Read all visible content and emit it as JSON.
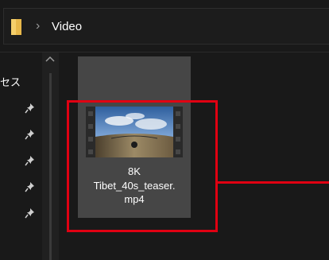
{
  "address_bar": {
    "folder_icon": "folder-icon",
    "separator": "›",
    "breadcrumb": "Video"
  },
  "nav_pane": {
    "partial_label": "セス",
    "pin_icon": "pin-icon",
    "scroll_up_icon": "chevron-up-icon"
  },
  "file": {
    "thumbnail": "panorama-video-thumbnail",
    "name_lines": [
      "8K",
      "Tibet_40s_teaser.",
      "mp4"
    ]
  },
  "colors": {
    "background": "#191919",
    "tile_selected": "#464646",
    "annotation_red": "#e00012"
  }
}
